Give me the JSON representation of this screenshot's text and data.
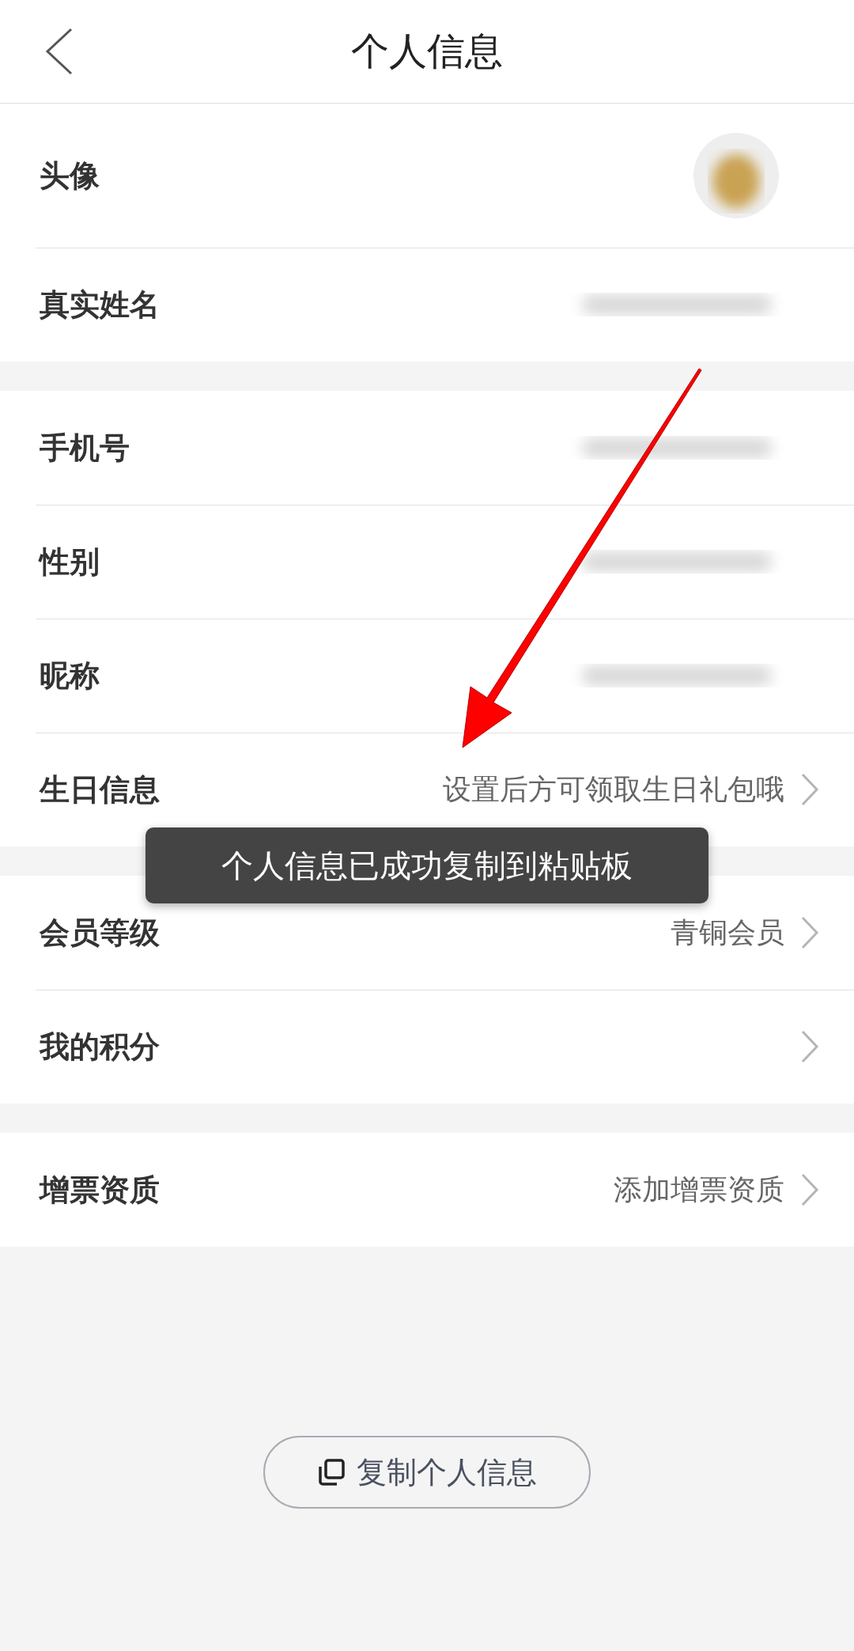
{
  "header": {
    "title": "个人信息"
  },
  "sections": [
    {
      "rows": [
        {
          "label": "头像",
          "kind": "avatar"
        },
        {
          "label": "真实姓名",
          "kind": "hidden"
        }
      ]
    },
    {
      "rows": [
        {
          "label": "手机号",
          "kind": "hidden"
        },
        {
          "label": "性别",
          "kind": "hidden"
        },
        {
          "label": "昵称",
          "kind": "hidden"
        },
        {
          "label": "生日信息",
          "kind": "link",
          "value": "设置后方可领取生日礼包哦"
        }
      ]
    },
    {
      "rows": [
        {
          "label": "会员等级",
          "kind": "link",
          "value": "青铜会员"
        },
        {
          "label": "我的积分",
          "kind": "link"
        }
      ]
    },
    {
      "rows": [
        {
          "label": "增票资质",
          "kind": "link",
          "value": "添加增票资质"
        }
      ]
    }
  ],
  "toast": {
    "text": "个人信息已成功复制到粘贴板"
  },
  "copy_button": {
    "label": "复制个人信息"
  }
}
